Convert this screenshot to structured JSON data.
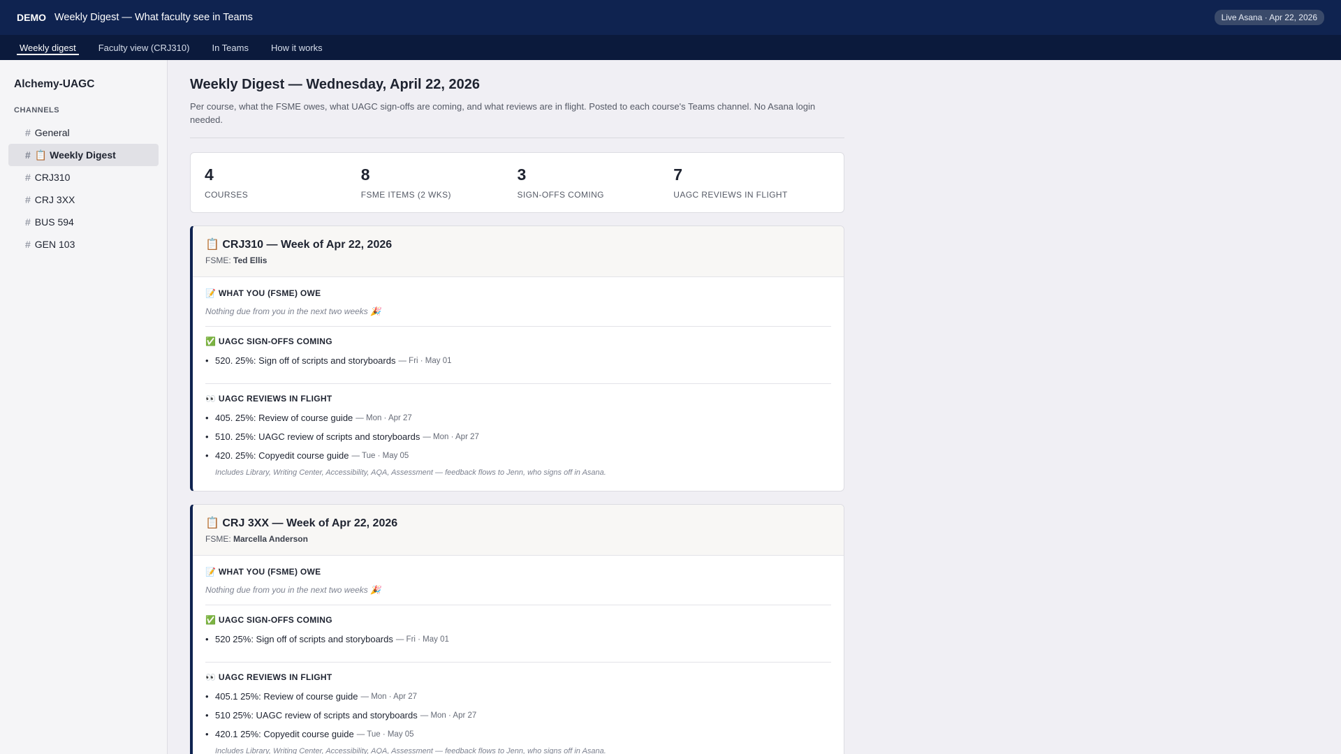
{
  "topbar": {
    "demo": "DEMO",
    "title": "Weekly Digest — What faculty see in Teams",
    "live_badge": "Live Asana · Apr 22, 2026"
  },
  "subnav": [
    {
      "label": "Weekly digest",
      "active": true
    },
    {
      "label": "Faculty view (CRJ310)",
      "active": false
    },
    {
      "label": "In Teams",
      "active": false
    },
    {
      "label": "How it works",
      "active": false
    }
  ],
  "sidebar": {
    "org": "Alchemy-UAGC",
    "section_label": "CHANNELS",
    "channels": [
      {
        "label": "General",
        "active": false
      },
      {
        "label": "📋 Weekly Digest",
        "active": true
      },
      {
        "label": "CRJ310",
        "active": false
      },
      {
        "label": "CRJ 3XX",
        "active": false
      },
      {
        "label": "BUS 594",
        "active": false
      },
      {
        "label": "GEN 103",
        "active": false
      }
    ]
  },
  "page": {
    "title": "Weekly Digest — Wednesday, April 22, 2026",
    "description": "Per course, what the FSME owes, what UAGC sign-offs are coming, and what reviews are in flight. Posted to each course's Teams channel. No Asana login needed."
  },
  "stats": [
    {
      "value": "4",
      "label": "COURSES"
    },
    {
      "value": "8",
      "label": "FSME ITEMS (2 WKS)"
    },
    {
      "value": "3",
      "label": "SIGN-OFFS COMING"
    },
    {
      "value": "7",
      "label": "UAGC REVIEWS IN FLIGHT"
    }
  ],
  "labels": {
    "fsme_prefix": "FSME:",
    "owe_heading": "📝 WHAT YOU (FSME) OWE",
    "signoffs_heading": "✅ UAGC SIGN-OFFS COMING",
    "reviews_heading": "👀 UAGC REVIEWS IN FLIGHT",
    "nothing_due": "Nothing due from you in the next two weeks 🎉",
    "footnote": "Includes Library, Writing Center, Accessibility, AQA, Assessment — feedback flows to Jenn, who signs off in Asana."
  },
  "courses": [
    {
      "title": "📋 CRJ310 — Week of Apr 22, 2026",
      "fsme": "Ted Ellis",
      "signoffs": [
        {
          "text": "520. 25%: Sign off of scripts and storyboards",
          "date": "— Fri · May 01"
        }
      ],
      "reviews": [
        {
          "text": "405. 25%: Review of course guide",
          "date": "— Mon · Apr 27"
        },
        {
          "text": "510. 25%: UAGC review of scripts and storyboards",
          "date": "— Mon · Apr 27"
        },
        {
          "text": "420. 25%: Copyedit course guide",
          "date": "— Tue · May 05"
        }
      ]
    },
    {
      "title": "📋 CRJ 3XX — Week of Apr 22, 2026",
      "fsme": "Marcella Anderson",
      "signoffs": [
        {
          "text": "520 25%: Sign off of scripts and storyboards",
          "date": "— Fri · May 01"
        }
      ],
      "reviews": [
        {
          "text": "405.1 25%: Review of course guide",
          "date": "— Mon · Apr 27"
        },
        {
          "text": "510 25%: UAGC review of scripts and storyboards",
          "date": "— Mon · Apr 27"
        },
        {
          "text": "420.1 25%: Copyedit course guide",
          "date": "— Tue · May 05"
        }
      ]
    }
  ]
}
